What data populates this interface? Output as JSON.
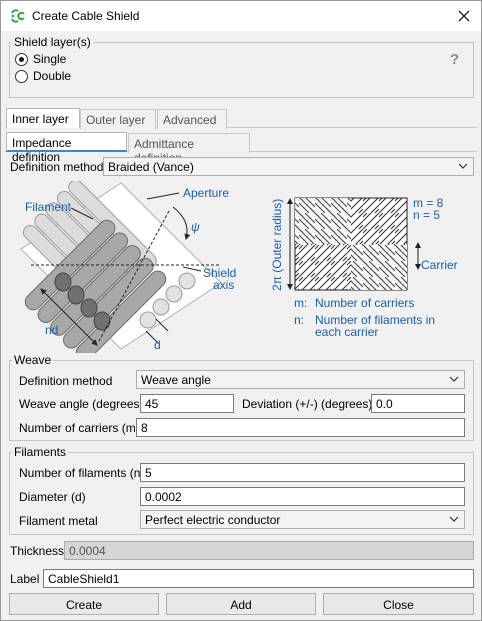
{
  "window": {
    "title": "Create Cable Shield",
    "app_icon": "cable-logo-icon",
    "close_icon": "close-icon"
  },
  "shield_layers": {
    "legend": "Shield layer(s)",
    "options": [
      {
        "label": "Single",
        "selected": true
      },
      {
        "label": "Double",
        "selected": false
      }
    ],
    "help": "?"
  },
  "layer_tabs": [
    {
      "label": "Inner layer",
      "active": true
    },
    {
      "label": "Outer layer",
      "active": false
    },
    {
      "label": "Advanced",
      "active": false
    }
  ],
  "definition_tabs": [
    {
      "label": "Impedance definition",
      "active": true
    },
    {
      "label": "Admittance definition",
      "active": false
    }
  ],
  "definition_method": {
    "label": "Definition method",
    "value": "Braided (Vance)"
  },
  "diagram": {
    "left": {
      "filament": "Filament",
      "aperture": "Aperture",
      "psi": "ψ",
      "shield_axis_1": "Shield",
      "shield_axis_2": "axis",
      "nd": "nd",
      "d": "d"
    },
    "right": {
      "vertical_label": "2π (Outer radius)",
      "m_eq": "m = 8",
      "n_eq": "n = 5",
      "carrier": "Carrier",
      "legend_m_key": "m:",
      "legend_m_val": "Number of carriers",
      "legend_n_key": "n:",
      "legend_n_val_1": "Number of filaments in",
      "legend_n_val_2": "each carrier"
    }
  },
  "weave": {
    "legend": "Weave",
    "method_label": "Definition method",
    "method_value": "Weave angle",
    "angle_label": "Weave angle (degrees)",
    "angle_value": "45",
    "deviation_label": "Deviation (+/-) (degrees)",
    "deviation_value": "0.0",
    "carriers_label": "Number of carriers (m)",
    "carriers_value": "8"
  },
  "filaments": {
    "legend": "Filaments",
    "count_label": "Number of filaments (n)",
    "count_value": "5",
    "diameter_label": "Diameter (d)",
    "diameter_value": "0.0002",
    "metal_label": "Filament metal",
    "metal_value": "Perfect electric conductor"
  },
  "thickness": {
    "label": "Thickness",
    "value": "0.0004"
  },
  "label_field": {
    "label": "Label",
    "value": "CableShield1"
  },
  "buttons": {
    "create": "Create",
    "add": "Add",
    "close": "Close"
  },
  "colors": {
    "accent_blue": "#1b5fa8",
    "tab_underline": "#3b88c8"
  }
}
